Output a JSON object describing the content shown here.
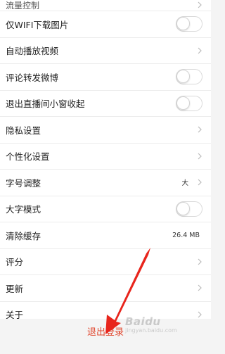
{
  "settings": {
    "cut_row_label": "流量控制",
    "wifi_images_label": "仅WIFI下载图片",
    "autoplay_label": "自动播放视频",
    "repost_weibo_label": "评论转发微博",
    "live_minimize_label": "退出直播间小窗收起",
    "privacy_label": "隐私设置",
    "personal_label": "个性化设置",
    "font_size_label": "字号调整",
    "font_size_value": "大",
    "big_font_label": "大字模式",
    "cache_label": "清除缓存",
    "cache_value": "26.4 MB",
    "rate_label": "评分",
    "update_label": "更新",
    "about_label": "关于"
  },
  "toggles": {
    "wifi_images": false,
    "repost_weibo": false,
    "live_minimize": false,
    "big_font": false
  },
  "logout_label": "退出登录",
  "watermark": {
    "brand": "Baidu",
    "sub": "jingyan.baidu.com"
  },
  "colors": {
    "accent": "#e0452c",
    "arrow": "#e8251c"
  }
}
